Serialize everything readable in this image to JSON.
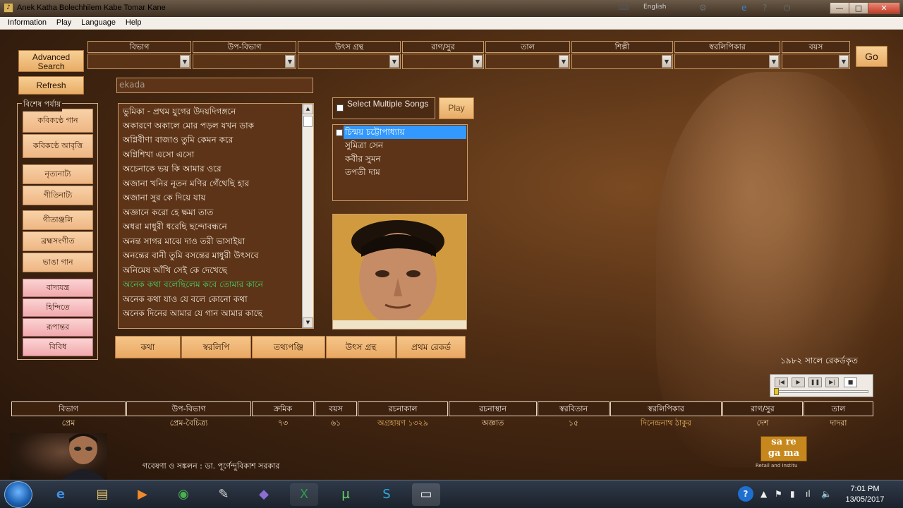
{
  "window": {
    "title": "Anek Katha Bolechhilem Kabe Tomar Kane",
    "language_indicator": "English",
    "controls": {
      "minimize": "—",
      "maximize": "□",
      "close": "✕"
    }
  },
  "menu": [
    "Information",
    "Play",
    "Language",
    "Help"
  ],
  "left_buttons": {
    "advanced_search": "Advanced Search",
    "refresh": "Refresh"
  },
  "filters": [
    "বিভাগ",
    "উপ-বিভাগ",
    "উৎস গ্রন্থ",
    "রাগ/সুর",
    "তাল",
    "শিল্পী",
    "স্বরলিপিকার",
    "বয়স"
  ],
  "go_label": "Go",
  "search": {
    "value": "ekada"
  },
  "special_section": {
    "legend": "বিশেষ পর্যায়",
    "orange_items": [
      "কবিকণ্ঠে গান",
      "কবিকণ্ঠে আবৃত্তি"
    ],
    "peach_group1": [
      "নৃত্যনাট্য",
      "গীতিনাট্য"
    ],
    "peach_group2": [
      "গীতাঞ্জলি",
      "ব্রহ্মসংগীত",
      "ভাঙা গান"
    ],
    "pink_items": [
      "বাদ্যযন্ত্র",
      "হিন্দিতে",
      "রূপান্তর",
      "বিবিধ"
    ]
  },
  "songs": [
    "ভুমিকা - প্রথম যুগের উদয়দিগঙ্গনে",
    "অকারণে অকালে মোর পড়ল যখন ডাক",
    "অগ্নিবীণা বাজাও তুমি কেমন করে",
    "অগ্নিশিখা এসো এসো",
    "অচেনাকে ভয় কি আমার ওরে",
    "অজানা খনির নূতন মণির গেঁথেছি হার",
    "অজানা সুর কে দিয়ে যায়",
    "অজ্ঞানে করো হে ক্ষমা তাত",
    "অধরা মাধুরী ধরেছি ছন্দোবন্ধনে",
    "অনন্ত সাগর মাঝে দাও তরী ভাসাইয়া",
    "অনন্তের বানী তুমি বসন্তের মাধুরী উৎসবে",
    "অনিমেষ আঁখি সেই কে দেখেছে",
    "অনেক কথা বলেছিলেম কবে তোমার কানে",
    "অনেক কথা যাও যে বলে কোনো কথা",
    "অনেক দিনের আমার যে গান আমার কাছে"
  ],
  "selected_song_index": 12,
  "select_multiple": {
    "label": "Select Multiple Songs",
    "play": "Play"
  },
  "artists": [
    "চিন্ময় চট্টোপাধ্যায়",
    "সুমিত্রা সেন",
    "কবীর সুমন",
    "তপতী দাম"
  ],
  "selected_artist_index": 0,
  "tabs": [
    "কথা",
    "স্বরলিপি",
    "তথ্যপঞ্জি",
    "উৎস গ্রন্থ",
    "প্রথম রেকর্ড"
  ],
  "recorded_text": "১৯৮২ সালে রেকর্ডকৃত",
  "player_icons": [
    "prev-icon",
    "play-icon",
    "pause-icon",
    "next-icon",
    "stop-icon"
  ],
  "details": {
    "headers": [
      "বিভাগ",
      "উপ-বিভাগ",
      "ক্রমিক",
      "বয়স",
      "রচনাকাল",
      "রচনাস্থান",
      "স্বরবিতান",
      "স্বরলিপিকার",
      "রাগ/সুর",
      "তাল"
    ],
    "values": [
      "প্রেম",
      "প্রেম-বৈচিত্র্য",
      "৭৩",
      "৬১",
      "অগ্রহায়ণ ১৩২৯",
      "অজ্ঞাত",
      "১৫",
      "দিনেন্দ্রনাথ ঠাকুর",
      "দেশ",
      "দাদরা"
    ]
  },
  "research_credit": "গবেষণা ও সঙ্কলন : ডা. পূর্ণেন্দুবিকাশ সরকার",
  "logo": {
    "line1": "sa re",
    "line2": "ga ma",
    "sub": "Retail and Institu"
  },
  "taskbar": {
    "apps": [
      "ie-icon",
      "explorer-icon",
      "media-player-icon",
      "chrome-icon",
      "paint-icon",
      "vs-icon",
      "excel-icon",
      "utorrent-icon",
      "skype-icon",
      "window-icon"
    ],
    "time": "7:01 PM",
    "date": "13/05/2017"
  },
  "colors": {
    "accent_orange": "#f3c186",
    "selected_song": "#45d36b",
    "selected_artist": "#3399ff"
  }
}
